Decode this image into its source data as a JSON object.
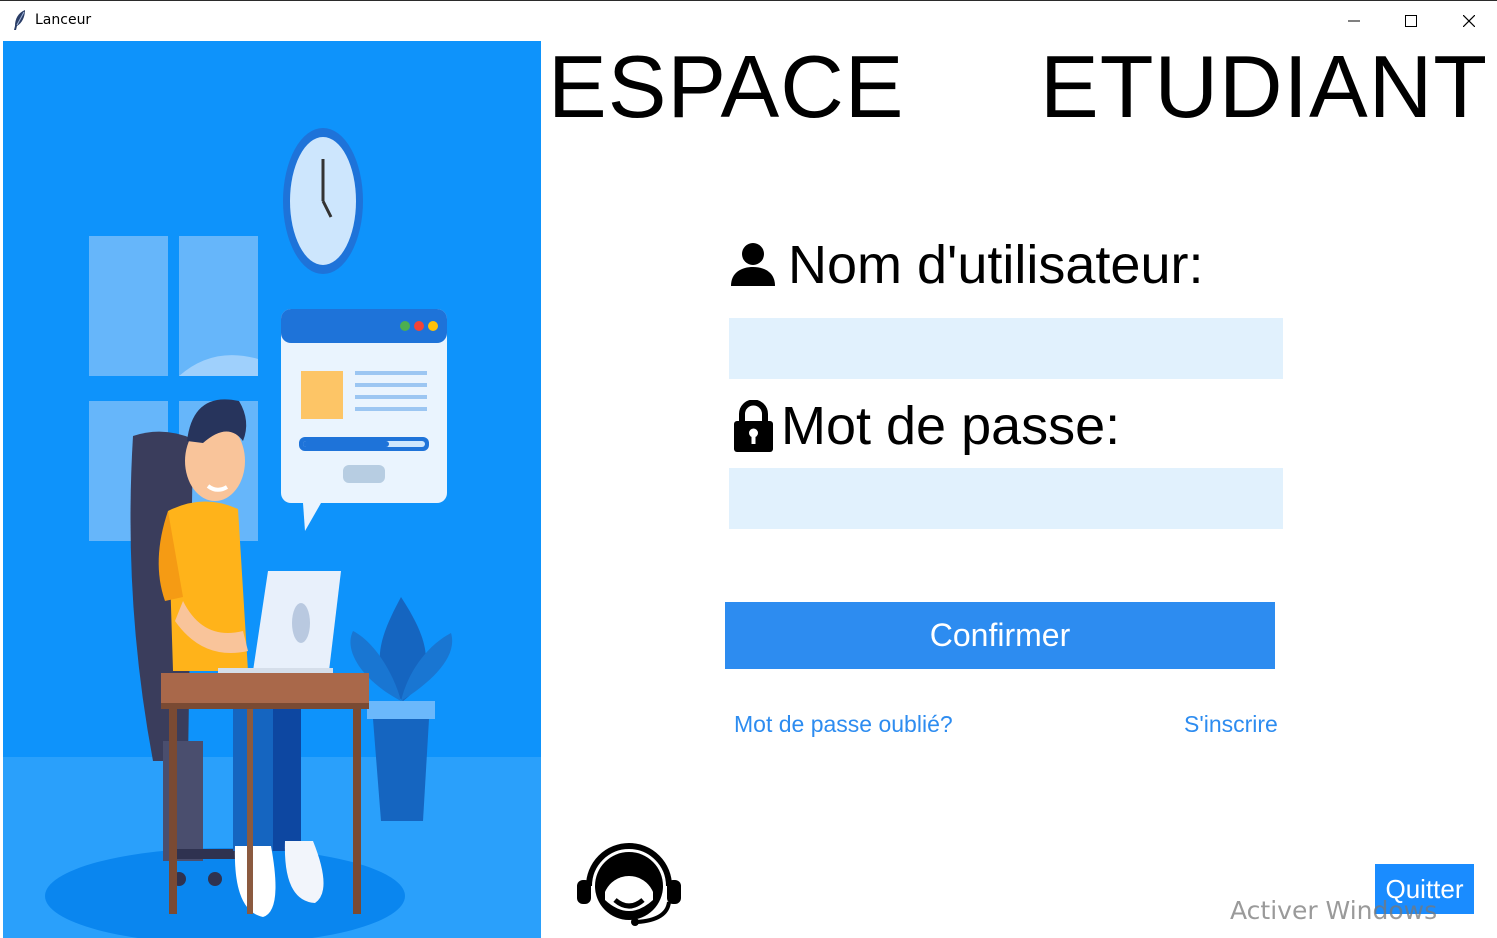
{
  "window": {
    "title": "Lanceur",
    "controls": [
      "minimize-icon",
      "maximize-icon",
      "close-icon"
    ]
  },
  "heading": {
    "word1": "ESPACE",
    "word2": "ETUDIANT"
  },
  "form": {
    "username_label": "Nom d'utilisateur:",
    "username_value": "",
    "password_label": "Mot de passe:",
    "password_value": "",
    "confirm_label": "Confirmer",
    "forgot_label": "Mot de passe oublié?",
    "signup_label": "S'inscrire"
  },
  "footer": {
    "quit_label": "Quitter",
    "watermark": "Activer Windows"
  },
  "icons": {
    "user": "user-icon",
    "lock": "lock-icon",
    "support": "headset-support-icon"
  },
  "colors": {
    "accent": "#2d8cf0",
    "field_bg": "#e1f1fd",
    "illustration_bg": "#0e93fb"
  }
}
